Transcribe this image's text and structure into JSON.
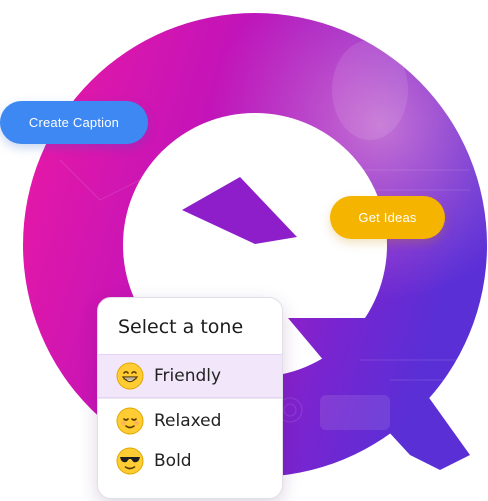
{
  "actions": {
    "create_caption_label": "Create Caption",
    "get_ideas_label": "Get Ideas"
  },
  "tone_picker": {
    "title": "Select a tone",
    "options": [
      {
        "label": "Friendly",
        "icon": "grinning-face-icon",
        "selected": true
      },
      {
        "label": "Relaxed",
        "icon": "relieved-face-icon",
        "selected": false
      },
      {
        "label": "Bold",
        "icon": "sunglasses-face-icon",
        "selected": false
      }
    ]
  },
  "colors": {
    "logo_magenta": "#e0139c",
    "logo_purple": "#6a1fc9",
    "create_caption_bg": "#3d88f2",
    "get_ideas_bg": "#f5b400",
    "selected_row_bg": "#f2e6fb"
  }
}
